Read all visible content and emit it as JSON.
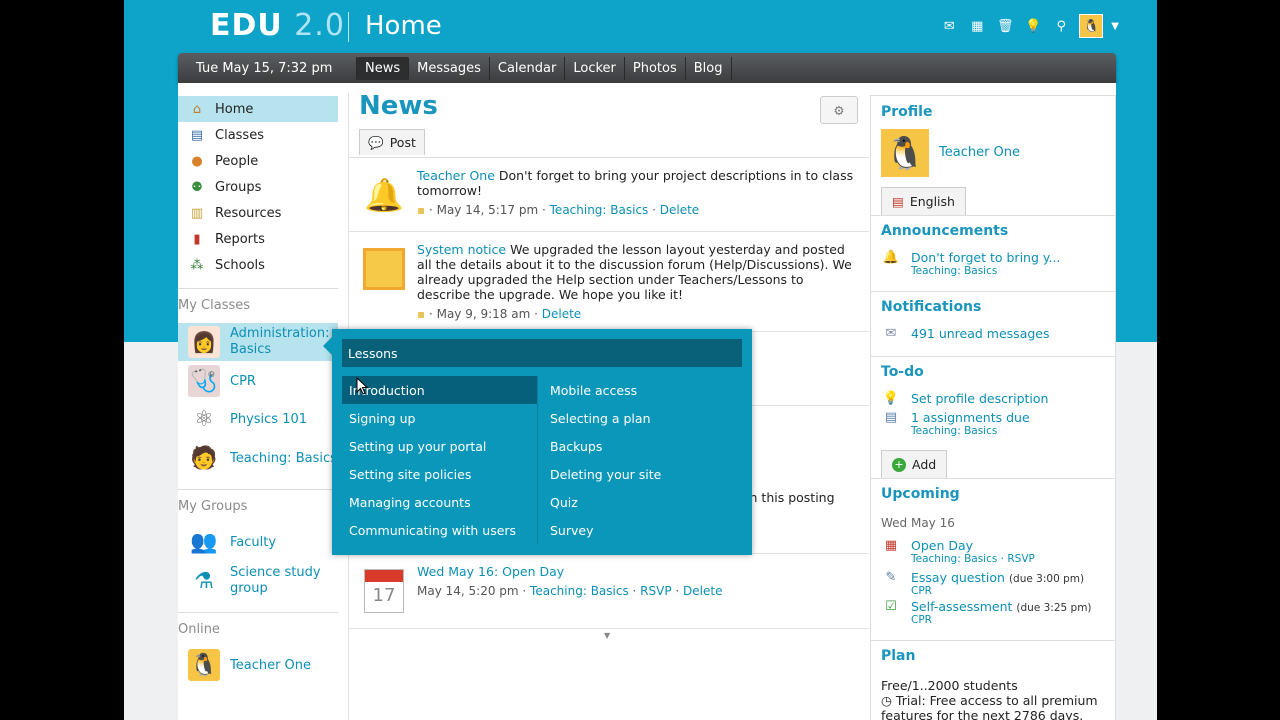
{
  "header": {
    "logo_main": "EDU",
    "logo_version": "2.0",
    "page_title": "Home"
  },
  "topbar": {
    "date": "Tue May 15, 7:32 pm",
    "tabs": [
      "News",
      "Messages",
      "Calendar",
      "Locker",
      "Photos",
      "Blog"
    ],
    "active_tab": "News"
  },
  "sidebar": {
    "items": [
      {
        "label": "Home",
        "icon": "home-icon"
      },
      {
        "label": "Classes",
        "icon": "book-icon"
      },
      {
        "label": "People",
        "icon": "person-icon"
      },
      {
        "label": "Groups",
        "icon": "group-icon"
      },
      {
        "label": "Resources",
        "icon": "resources-icon"
      },
      {
        "label": "Reports",
        "icon": "chart-icon"
      },
      {
        "label": "Schools",
        "icon": "schools-icon"
      }
    ],
    "my_classes_heading": "My Classes",
    "classes": [
      {
        "label_line1": "Administration:",
        "label_line2": "Basics"
      },
      {
        "label": "CPR"
      },
      {
        "label": "Physics 101"
      },
      {
        "label": "Teaching: Basics"
      }
    ],
    "my_groups_heading": "My Groups",
    "groups": [
      {
        "label": "Faculty"
      },
      {
        "label_line1": "Science study",
        "label_line2": "group"
      }
    ],
    "online_heading": "Online",
    "online": [
      {
        "label": "Teacher One"
      }
    ]
  },
  "main": {
    "title": "News",
    "post_tab": "Post",
    "posts": [
      {
        "author": "Teacher One",
        "text": " Don't forget to bring your project descriptions in to class tomorrow!",
        "meta_date": "May 14, 5:17 pm",
        "meta_class": "Teaching: Basics",
        "meta_delete": "Delete"
      },
      {
        "author": "System notice",
        "text": " We upgraded the lesson layout yesterday and posted all the details about it to the discussion forum (Help/Discussions). We already upgraded the Help section under Teachers/Lessons to describe the upgrade. We hope you like it!",
        "meta_date": "May 9, 9:18 am",
        "meta_delete": "Delete"
      },
      {
        "partial_text": "t on this posting"
      },
      {
        "calendar_day": "17",
        "title": "Wed May 16: Open Day",
        "meta_date": "May 14, 5:20 pm",
        "meta_class": "Teaching: Basics",
        "meta_rsvp": "RSVP",
        "meta_delete": "Delete"
      }
    ]
  },
  "lessons_menu": {
    "title": "Lessons",
    "left": [
      "Introduction",
      "Signing up",
      "Setting up your portal",
      "Setting site policies",
      "Managing accounts",
      "Communicating with users"
    ],
    "right": [
      "Mobile access",
      "Selecting a plan",
      "Backups",
      "Deleting your site",
      "Quiz",
      "Survey"
    ]
  },
  "right": {
    "profile_heading": "Profile",
    "profile_name": "Teacher One",
    "language_button": "English",
    "announcements_heading": "Announcements",
    "announcement_title": "Don't forget to bring y...",
    "announcement_class": "Teaching: Basics",
    "notifications_heading": "Notifications",
    "notifications_text": "491 unread messages",
    "todo_heading": "To-do",
    "todo_1": "Set profile description",
    "todo_2": "1 assignments due",
    "todo_2_class": "Teaching: Basics",
    "add_button": "Add",
    "upcoming_heading": "Upcoming",
    "upcoming_date": "Wed May 16",
    "up_1_title": "Open Day",
    "up_1_class": "Teaching: Basics",
    "up_1_rsvp": "RSVP",
    "up_2_title": "Essay question",
    "up_2_due": "(due 3:00 pm)",
    "up_2_class": "CPR",
    "up_3_title": "Self-assessment",
    "up_3_due": "(due 3:25 pm)",
    "up_3_class": "CPR",
    "plan_heading": "Plan",
    "plan_line1": "Free/1..2000 students",
    "plan_line2": "Trial: Free access to all premium",
    "plan_line3": "features for the next 2786 days."
  },
  "colors": {
    "brand": "#0ea3c9",
    "link": "#0c8fb5",
    "menu_bg": "#0b97ba",
    "menu_dark": "#07607b"
  }
}
